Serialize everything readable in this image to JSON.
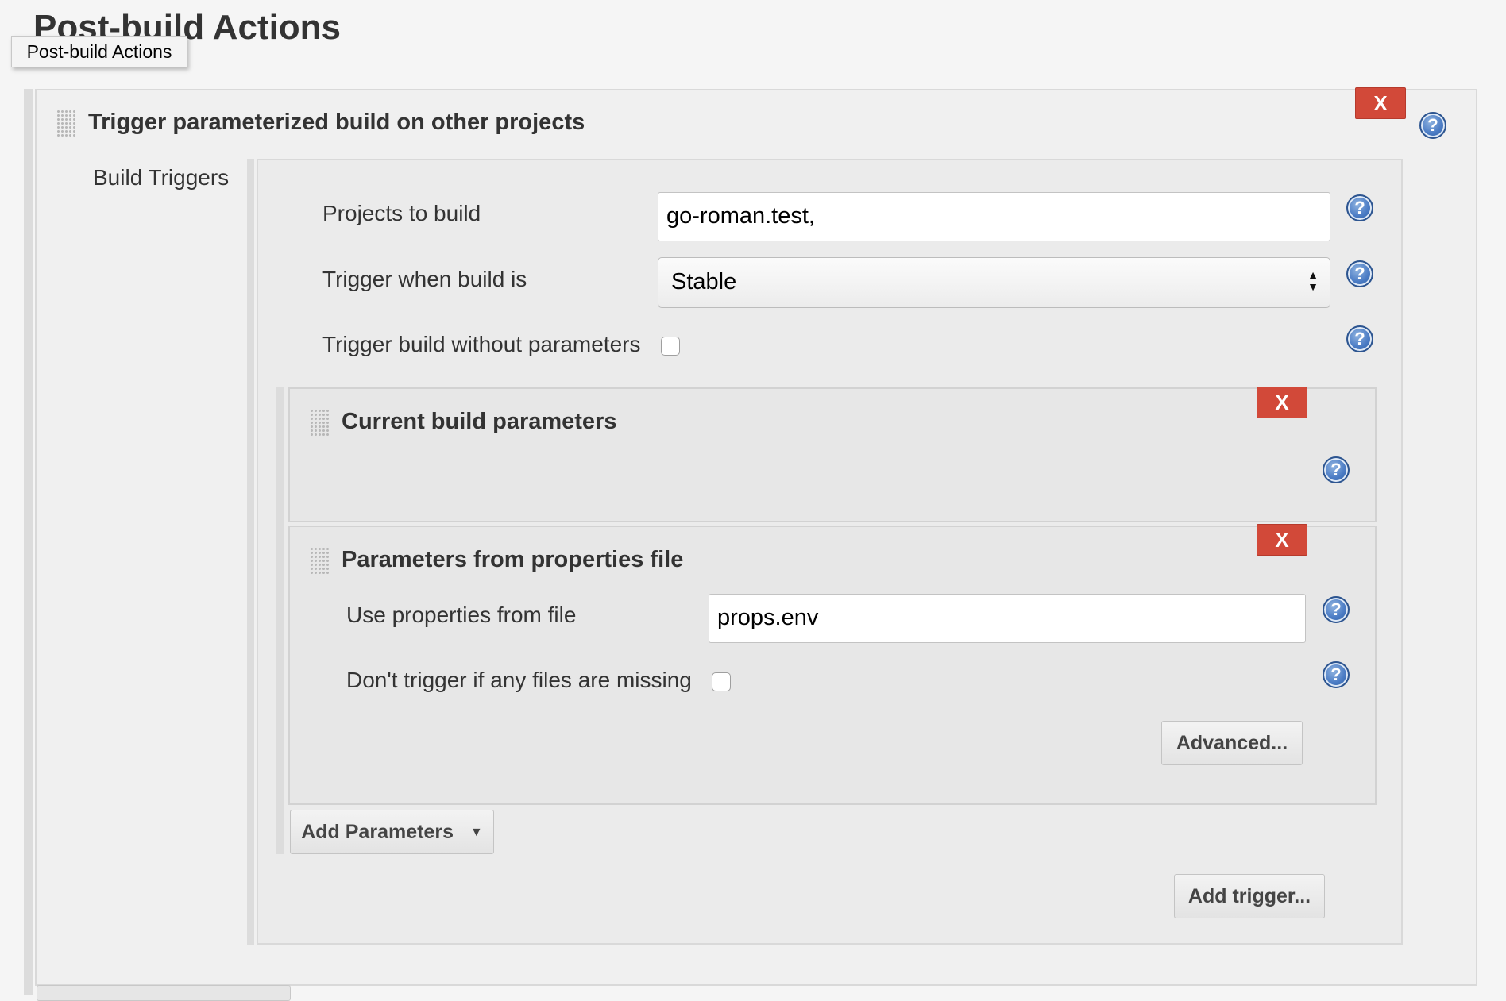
{
  "page": {
    "title": "Post-build Actions",
    "tooltip": "Post-build Actions"
  },
  "trigger_section": {
    "title": "Trigger parameterized build on other projects",
    "delete_label": "X",
    "build_triggers_label": "Build Triggers",
    "projects_to_build": {
      "label": "Projects to build",
      "value": "go-roman.test,"
    },
    "trigger_when": {
      "label": "Trigger when build is",
      "selected": "Stable"
    },
    "without_params": {
      "label": "Trigger build without parameters",
      "checked": false
    },
    "current_params": {
      "title": "Current build parameters",
      "delete_label": "X"
    },
    "props_params": {
      "title": "Parameters from properties file",
      "delete_label": "X",
      "use_file": {
        "label": "Use properties from file",
        "value": "props.env"
      },
      "dont_trigger": {
        "label": "Don't trigger if any files are missing",
        "checked": false
      },
      "advanced_label": "Advanced..."
    },
    "add_parameters_label": "Add Parameters",
    "add_trigger_label": "Add trigger..."
  },
  "icons": {
    "help": "help-icon",
    "drag": "drag-handle-icon",
    "dropdown": "caret-down-icon"
  },
  "colors": {
    "danger": "#d24939",
    "help": "#4a7bc4",
    "panel": "#ebebeb"
  }
}
